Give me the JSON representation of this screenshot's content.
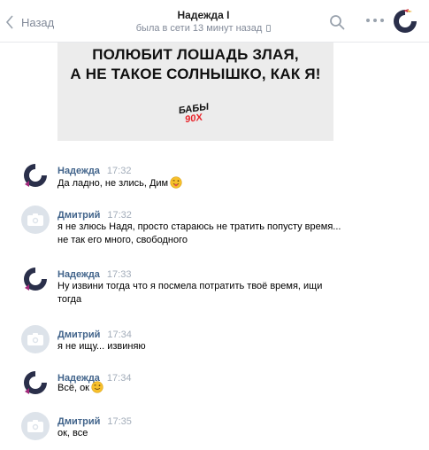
{
  "header": {
    "back_label": "Назад",
    "contact_name": "Надежда I",
    "last_seen": "была в сети 13 минут назад"
  },
  "poster": {
    "line1": "ПОЛЮБИТ ЛОШАДЬ ЗЛАЯ,",
    "line2": "А НЕ ТАКОЕ СОЛНЫШКО, КАК Я!",
    "logo_top": "БАБЫ",
    "logo_bottom": "90Х"
  },
  "messages": [
    {
      "author": "Надежда",
      "time": "17:32",
      "text": "Да ладно, не злись, Дим"
    },
    {
      "author": "Дмитрий",
      "time": "17:32",
      "text": "я не злюсь Надя, просто стараюсь не тратить попусту время...\nне так его много, свободного"
    },
    {
      "author": "Надежда",
      "time": "17:33",
      "text": "Ну извини тогда что я посмела потратить твоё время, ищи\nтогда"
    },
    {
      "author": "Дмитрий",
      "time": "17:34",
      "text": "я не ищу... извиняю"
    },
    {
      "author": "Надежда",
      "time": "17:34",
      "text": "Всё, ок"
    },
    {
      "author": "Дмитрий",
      "time": "17:35",
      "text": "ок, все"
    }
  ],
  "icons": {
    "back": "chevron-left-icon",
    "search": "search-icon",
    "more": "more-icon",
    "camera": "camera-icon",
    "emoji": "smiley-icon"
  },
  "colors": {
    "author_link": "#42648b",
    "muted": "#828a99",
    "time": "#a3adba",
    "poster_bg": "#ececec",
    "logo_red": "#e8242b",
    "emoji_yellow": "#f7c02c"
  }
}
